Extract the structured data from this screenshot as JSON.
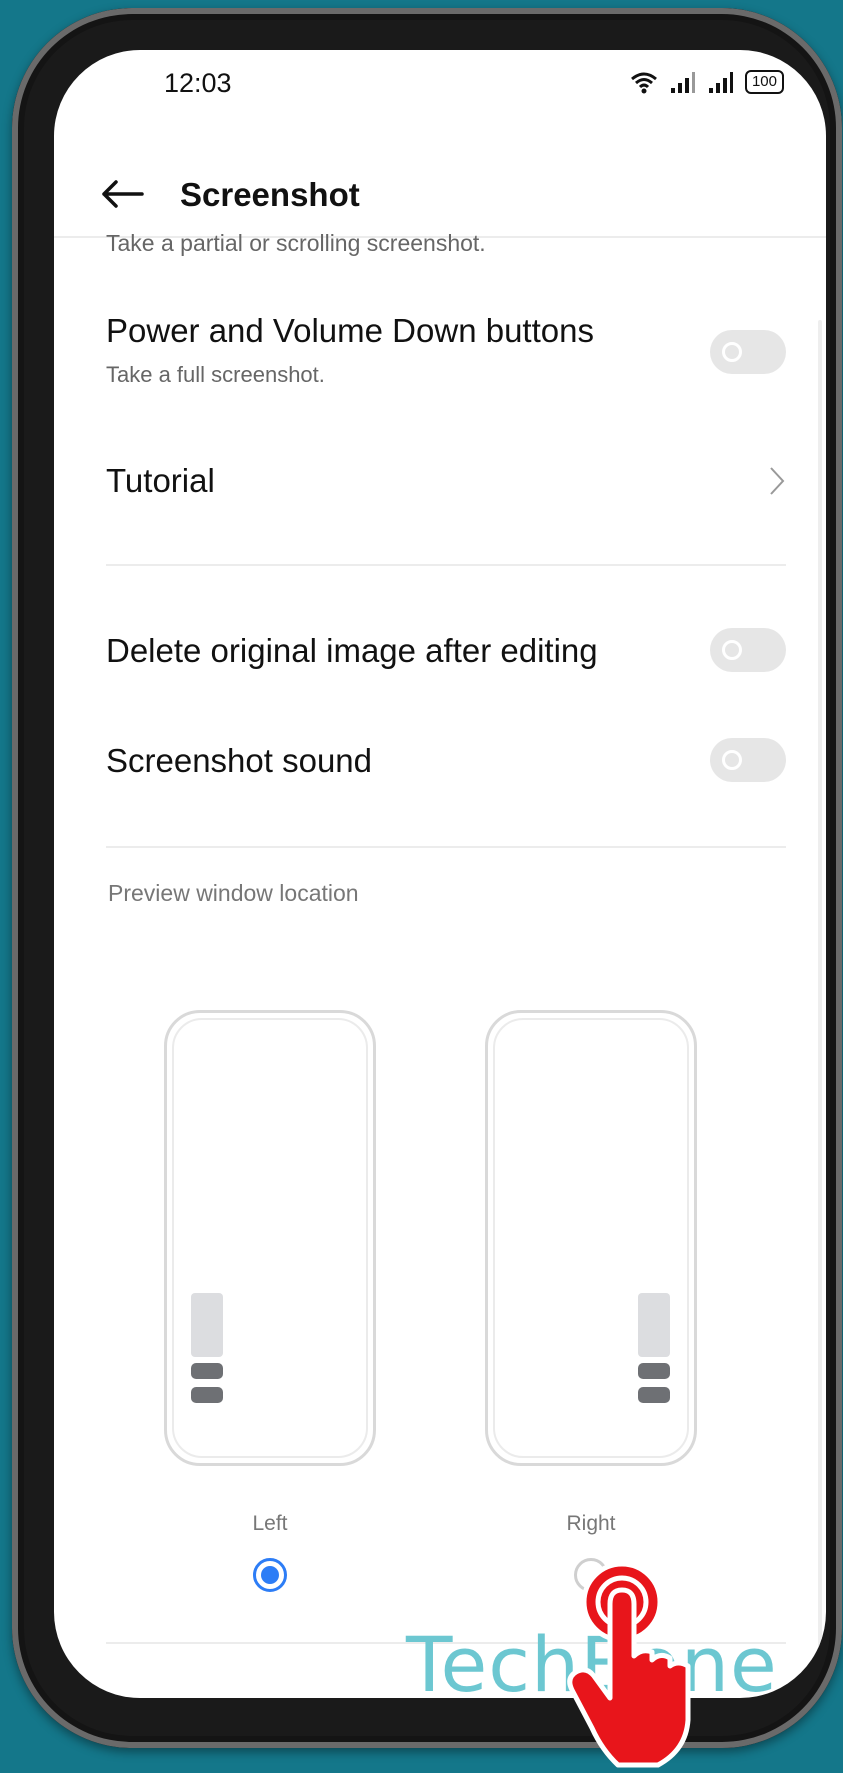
{
  "status_bar": {
    "time": "12:03",
    "battery": "100"
  },
  "header": {
    "title": "Screenshot"
  },
  "clipped_text": "Take a partial or scrolling screenshot.",
  "settings": {
    "power_volume": {
      "title": "Power and Volume Down buttons",
      "subtitle": "Take a full screenshot.",
      "enabled": false
    },
    "tutorial": {
      "title": "Tutorial"
    },
    "delete_original": {
      "title": "Delete original image after editing",
      "enabled": false
    },
    "sound": {
      "title": "Screenshot sound",
      "enabled": false
    }
  },
  "preview": {
    "label": "Preview window location",
    "options": [
      {
        "label": "Left",
        "selected": true
      },
      {
        "label": "Right",
        "selected": false
      }
    ]
  },
  "watermark": "TechBone",
  "colors": {
    "accent": "#2d7df6",
    "background": "#14778a",
    "hand": "#e8151b",
    "watermark": "#6cc7d1"
  }
}
